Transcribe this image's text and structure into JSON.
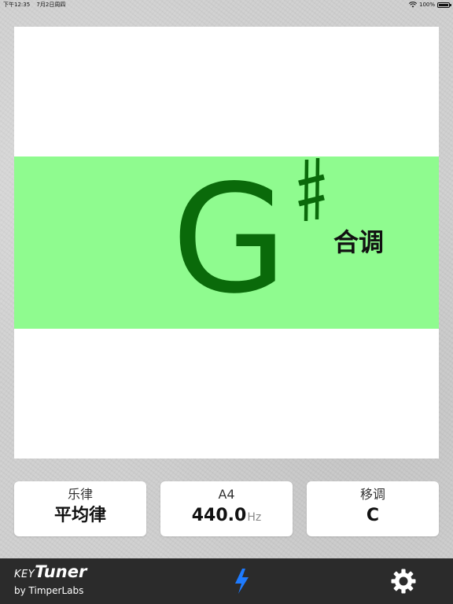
{
  "status_bar": {
    "time": "下午12:35",
    "date": "7月2日周四",
    "battery": "100%"
  },
  "tuner": {
    "note": "G",
    "accidental_icon": "sharp-icon",
    "state_label": "合调",
    "band_color": "#8ffb8f",
    "note_color": "#0a6a0a"
  },
  "settings_cards": {
    "temperament": {
      "title": "乐律",
      "value": "平均律"
    },
    "pitch": {
      "title": "A4",
      "value": "440.0",
      "unit": "Hz"
    },
    "transpose": {
      "title": "移调",
      "value": "C"
    }
  },
  "bottom_bar": {
    "brand_key": "KEY",
    "brand_tuner": "Tuner",
    "brand_by": "by TimperLabs",
    "bolt_icon": "lightning-bolt-icon",
    "bolt_color": "#1e7bff",
    "settings_icon": "gear-icon"
  }
}
